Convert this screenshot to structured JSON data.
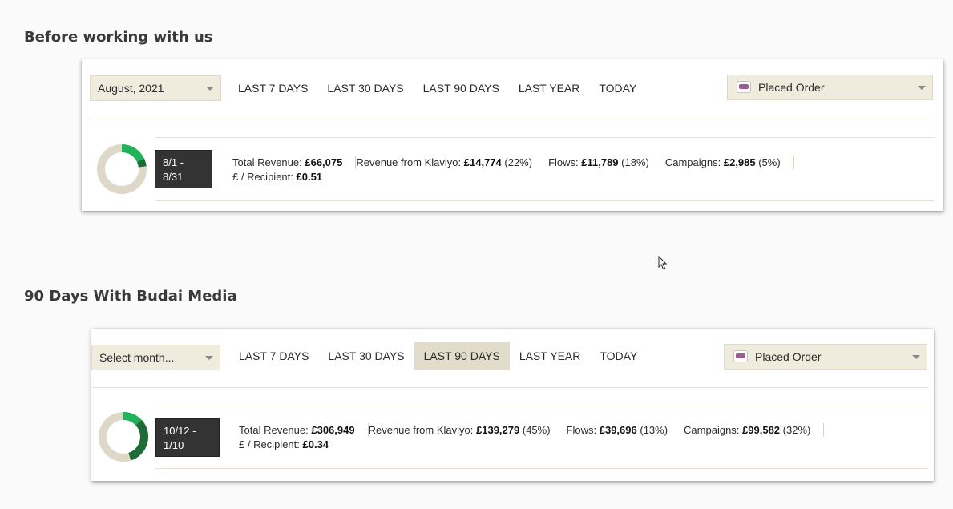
{
  "sections": [
    {
      "title": "Before working with us",
      "month_select": "August, 2021",
      "tabs": [
        "LAST 7 DAYS",
        "LAST 30 DAYS",
        "LAST 90 DAYS",
        "LAST YEAR",
        "TODAY"
      ],
      "active_tab": null,
      "event_select": "Placed Order",
      "date_range": [
        "8/1 -",
        "8/31"
      ],
      "stats": {
        "total_revenue_label": "Total Revenue:",
        "total_revenue_value": "£66,075",
        "per_recipient_label": "£ / Recipient:",
        "per_recipient_value": "£0.51",
        "klaviyo_label": "Revenue from Klaviyo:",
        "klaviyo_value": "£14,774",
        "klaviyo_pct": "(22%)",
        "flows_label": "Flows:",
        "flows_value": "£11,789",
        "flows_pct": "(18%)",
        "campaigns_label": "Campaigns:",
        "campaigns_value": "£2,985",
        "campaigns_pct": "(5%)"
      },
      "donut": {
        "flows_pct": 18,
        "campaigns_pct": 5
      }
    },
    {
      "title": "90 Days With Budai Media",
      "month_select": "Select month...",
      "tabs": [
        "LAST 7 DAYS",
        "LAST 30 DAYS",
        "LAST 90 DAYS",
        "LAST YEAR",
        "TODAY"
      ],
      "active_tab": "LAST 90 DAYS",
      "event_select": "Placed Order",
      "date_range": [
        "10/12 -",
        "1/10"
      ],
      "stats": {
        "total_revenue_label": "Total Revenue:",
        "total_revenue_value": "£306,949",
        "per_recipient_label": "£ / Recipient:",
        "per_recipient_value": "£0.34",
        "klaviyo_label": "Revenue from Klaviyo:",
        "klaviyo_value": "£139,279",
        "klaviyo_pct": "(45%)",
        "flows_label": "Flows:",
        "flows_value": "£39,696",
        "flows_pct": "(13%)",
        "campaigns_label": "Campaigns:",
        "campaigns_value": "£99,582",
        "campaigns_pct": "(32%)"
      },
      "donut": {
        "flows_pct": 13,
        "campaigns_pct": 32
      }
    }
  ],
  "colors": {
    "flows": "#22b35a",
    "campaigns": "#1d6b36",
    "remainder": "#ddd8c7",
    "active_tab_bg": "#e2dccb",
    "select_bg": "#efebdd"
  },
  "icons": {
    "event_source": "woocommerce-icon",
    "cursor": "mouse-cursor-icon"
  }
}
